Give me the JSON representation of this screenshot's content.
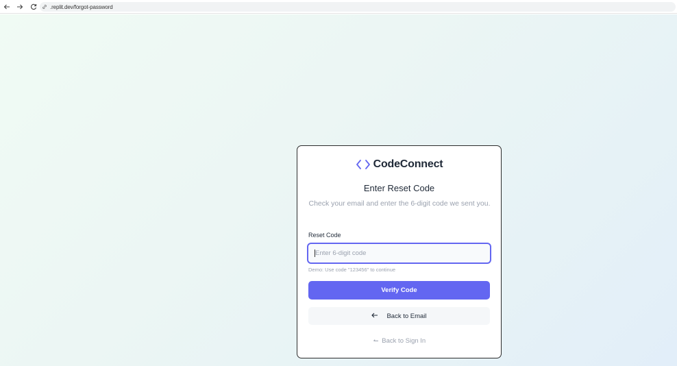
{
  "browser": {
    "url": ".replit.dev/forgot-password"
  },
  "brand": {
    "name": "CodeConnect",
    "icon": "code-brackets-icon",
    "accent_color": "#6366f1"
  },
  "card": {
    "title": "Enter Reset Code",
    "subtitle": "Check your email and enter the 6-digit code we sent you.",
    "field_label": "Reset Code",
    "input_value": "",
    "input_placeholder": "Enter 6-digit code",
    "hint": "Demo: Use code \"123456\" to continue",
    "verify_label": "Verify Code",
    "back_email_label": "Back to Email",
    "back_email_icon": "arrow-left-icon",
    "back_signin_label": "Back to Sign In",
    "back_signin_icon": "arrow-left-icon"
  }
}
